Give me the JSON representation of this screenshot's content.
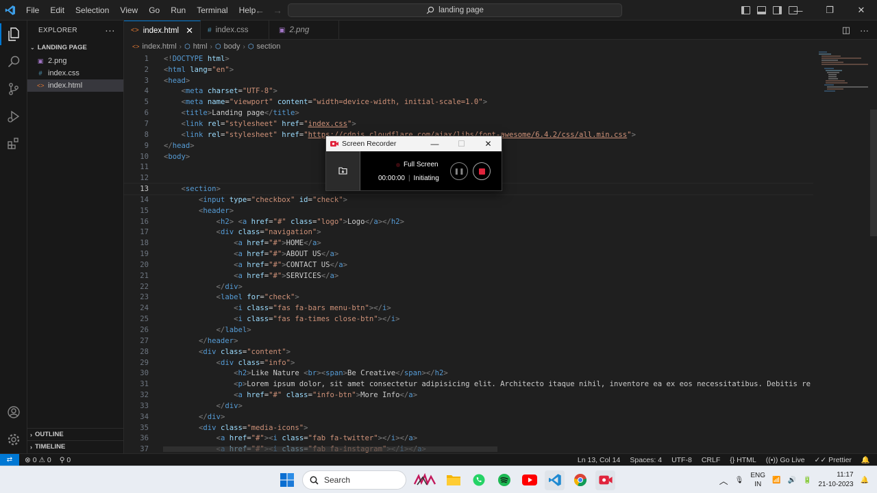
{
  "titlebar": {
    "menu": [
      "File",
      "Edit",
      "Selection",
      "View",
      "Go",
      "Run",
      "Terminal",
      "Help"
    ],
    "search": "landing page",
    "window_controls": [
      "—",
      "❐",
      "✕"
    ]
  },
  "sidebar": {
    "title": "EXPLORER",
    "more": "···",
    "folder": "LANDING PAGE",
    "files": [
      {
        "name": "2.png",
        "icon": "image-file-icon"
      },
      {
        "name": "index.css",
        "icon": "css-file-icon"
      },
      {
        "name": "index.html",
        "icon": "html-file-icon"
      }
    ],
    "outline": "OUTLINE",
    "timeline": "TIMELINE"
  },
  "tabs": [
    {
      "label": "index.html",
      "active": true,
      "icon": "<>"
    },
    {
      "label": "index.css",
      "active": false,
      "icon": "#"
    },
    {
      "label": "2.png",
      "active": false,
      "icon": "▣"
    }
  ],
  "breadcrumb": [
    "index.html",
    "html",
    "body",
    "section"
  ],
  "editor": {
    "start_line": 1,
    "current_line": 13
  },
  "statusbar": {
    "problems": "0",
    "warnings": "0",
    "ports": "0",
    "position": "Ln 13, Col 14",
    "spaces": "Spaces: 4",
    "encoding": "UTF-8",
    "eol": "CRLF",
    "language": "HTML",
    "golive": "Go Live",
    "prettier": "Prettier"
  },
  "recorder": {
    "title": "Screen Recorder",
    "mode": "Full Screen",
    "time": "00:00:00",
    "status": "Initiating"
  },
  "taskbar": {
    "search": "Search",
    "lang_top": "ENG",
    "lang_bottom": "IN",
    "time": "11:17",
    "date": "21-10-2023"
  },
  "colors": {
    "accent": "#0078d4",
    "tag": "#569cd6",
    "attr": "#9cdcfe",
    "string": "#ce9178",
    "record": "#e0243c"
  }
}
